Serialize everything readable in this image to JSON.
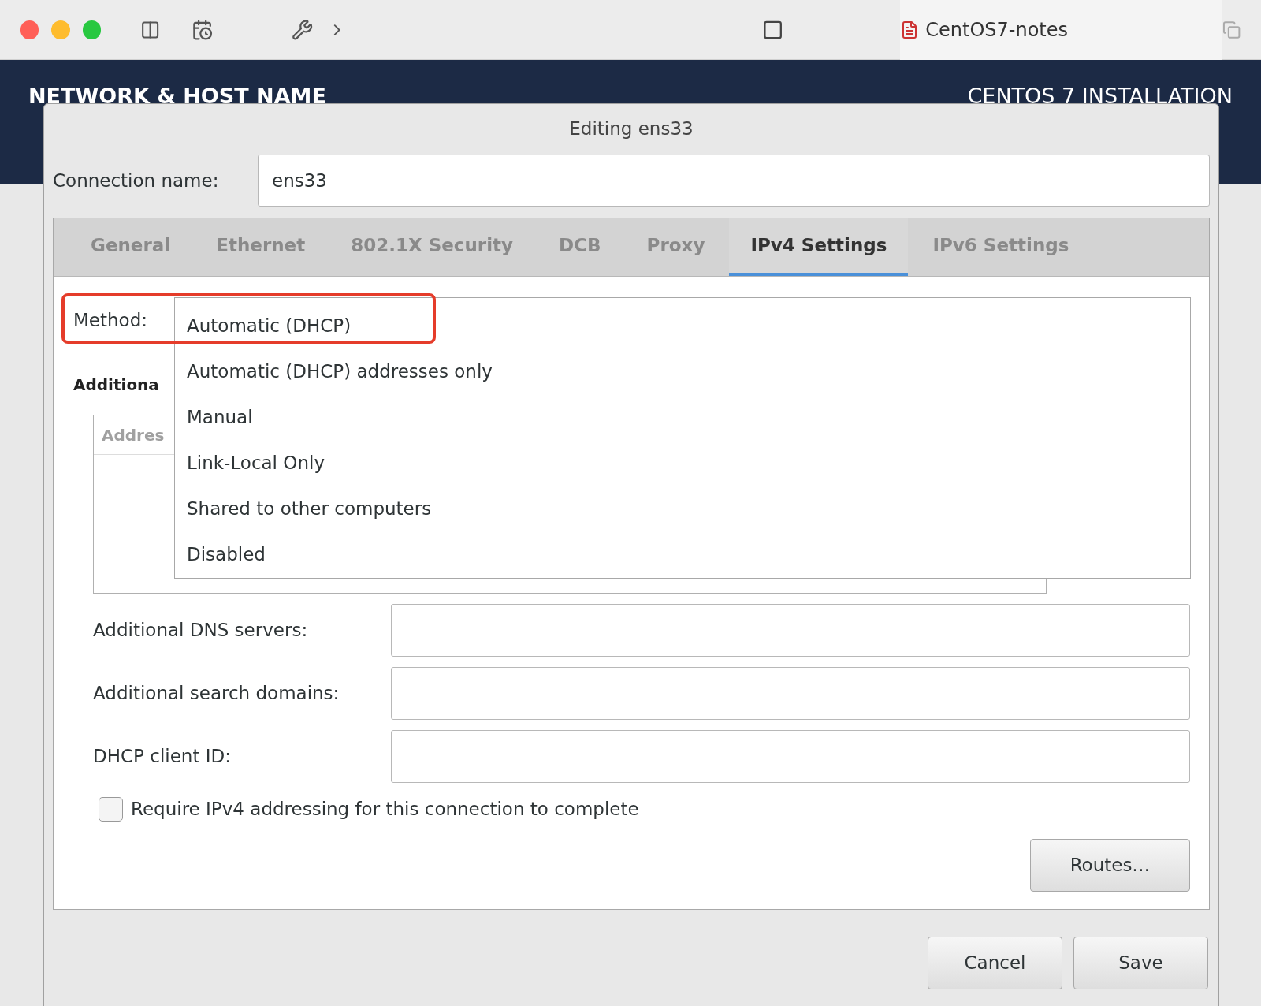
{
  "browser": {
    "tab_title": "CentOS7-notes"
  },
  "installer": {
    "title": "NETWORK & HOST NAME",
    "product": "CENTOS 7 INSTALLATION"
  },
  "dialog": {
    "title": "Editing ens33",
    "connection_name": {
      "label": "Connection name:",
      "value": "ens33"
    },
    "tabs": [
      {
        "label": "General",
        "selected": false
      },
      {
        "label": "Ethernet",
        "selected": false
      },
      {
        "label": "802.1X Security",
        "selected": false
      },
      {
        "label": "DCB",
        "selected": false
      },
      {
        "label": "Proxy",
        "selected": false
      },
      {
        "label": "IPv4 Settings",
        "selected": true
      },
      {
        "label": "IPv6 Settings",
        "selected": false
      }
    ],
    "method": {
      "label": "Method:",
      "annotated": true,
      "options": [
        {
          "label": "Automatic (DHCP)"
        },
        {
          "label": "Automatic (DHCP) addresses only"
        },
        {
          "label": "Manual"
        },
        {
          "label": "Link-Local Only"
        },
        {
          "label": "Shared to other computers"
        },
        {
          "label": "Disabled"
        }
      ]
    },
    "section_heading": "Additiona",
    "address_column": "Addres",
    "fields": [
      {
        "label": "Additional DNS servers:"
      },
      {
        "label": "Additional search domains:"
      },
      {
        "label": "DHCP client ID:"
      }
    ],
    "require_ipv4": {
      "label": "Require IPv4 addressing for this connection to complete",
      "checked": false
    },
    "routes_button": "Routes…",
    "buttons": [
      "Cancel",
      "Save"
    ]
  }
}
